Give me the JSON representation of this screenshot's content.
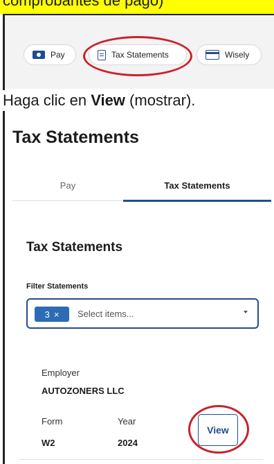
{
  "highlight_text": "comprobantes de pago)",
  "tab_bar": {
    "tabs": [
      {
        "label": "Pay",
        "icon": "money-icon"
      },
      {
        "label": "Tax Statements",
        "icon": "document-icon"
      },
      {
        "label": "Wisely",
        "icon": "card-icon"
      }
    ]
  },
  "instruction": {
    "prefix": "Haga clic en ",
    "bold": "View",
    "suffix": " (mostrar)."
  },
  "panel": {
    "page_title": "Tax Statements",
    "tabs": [
      "Pay",
      "Tax Statements"
    ],
    "section_title": "Tax Statements",
    "filter_label": "Filter Statements",
    "chip_count": "3",
    "chip_close": "×",
    "placeholder": "Select items...",
    "employer_label": "Employer",
    "employer_value": "AUTOZONERS LLC",
    "form_label": "Form",
    "form_value": "W2",
    "year_label": "Year",
    "year_value": "2024",
    "view_label": "View"
  },
  "colors": {
    "highlight": "#ffff00",
    "accent": "#1f4e8c",
    "chip": "#2d6cb5",
    "annotation": "#c8232c"
  }
}
